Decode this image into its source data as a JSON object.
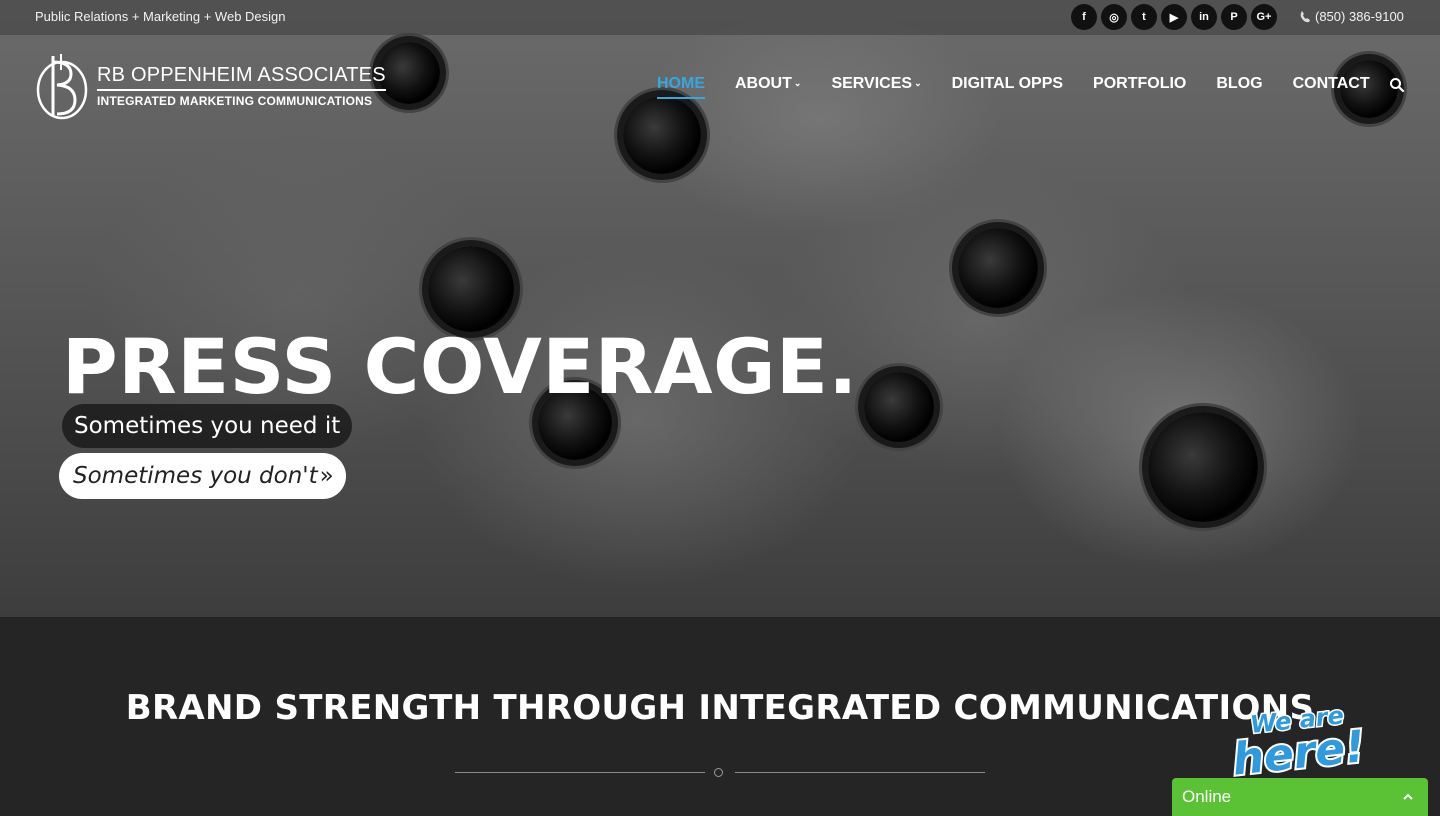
{
  "topbar": {
    "tagline": "Public Relations + Marketing + Web Design",
    "socials": [
      {
        "icon": "facebook-icon",
        "glyph": "f"
      },
      {
        "icon": "instagram-icon",
        "glyph": "◎"
      },
      {
        "icon": "twitter-icon",
        "glyph": "t"
      },
      {
        "icon": "youtube-icon",
        "glyph": "▶"
      },
      {
        "icon": "linkedin-icon",
        "glyph": "in"
      },
      {
        "icon": "pinterest-icon",
        "glyph": "P"
      },
      {
        "icon": "google-plus-icon",
        "glyph": "G+"
      }
    ],
    "phone": "(850) 386-9100"
  },
  "header": {
    "logo_name": "RB OPPENHEIM ASSOCIATES",
    "logo_sub": "INTEGRATED MARKETING COMMUNICATIONS",
    "nav": {
      "home": "HOME",
      "about": "ABOUT",
      "services": "SERVICES",
      "digital_opps": "DIGITAL OPPS",
      "portfolio": "PORTFOLIO",
      "blog": "BLOG",
      "contact": "CONTACT"
    },
    "caret": "⌄"
  },
  "hero": {
    "title": "PRESS COVERAGE.",
    "line1": "Sometimes you need it",
    "line2": "Sometimes you don't",
    "line2_arrow": "»"
  },
  "section": {
    "title": "BRAND STRENGTH THROUGH INTEGRATED COMMUNICATIONS"
  },
  "chat": {
    "badge_line1": "We are",
    "badge_line2": "here!",
    "status": "Online"
  },
  "colors": {
    "accent": "#35a8e0",
    "chat_green": "#5bc236",
    "dark_section": "#252526"
  }
}
